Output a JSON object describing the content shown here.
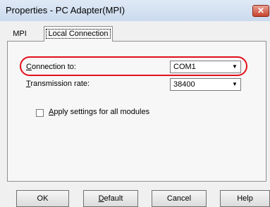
{
  "window": {
    "title": "Properties - PC Adapter(MPI)",
    "close_icon": "close-icon"
  },
  "tabs": [
    {
      "label": "MPI"
    },
    {
      "label": "Local Connection"
    }
  ],
  "connection_to": {
    "label_prefix": "C",
    "label_rest": "onnection to:",
    "value": "COM1"
  },
  "transmission_rate": {
    "label_prefix": "T",
    "label_rest": "ransmission rate:",
    "value": "38400"
  },
  "apply_all": {
    "label_prefix": "A",
    "label_rest": "pply settings for all modules",
    "checked": false
  },
  "buttons": {
    "ok": "OK",
    "default_prefix": "D",
    "default_rest": "efault",
    "cancel": "Cancel",
    "help": "Help"
  },
  "colors": {
    "highlight": "#e3101b"
  }
}
